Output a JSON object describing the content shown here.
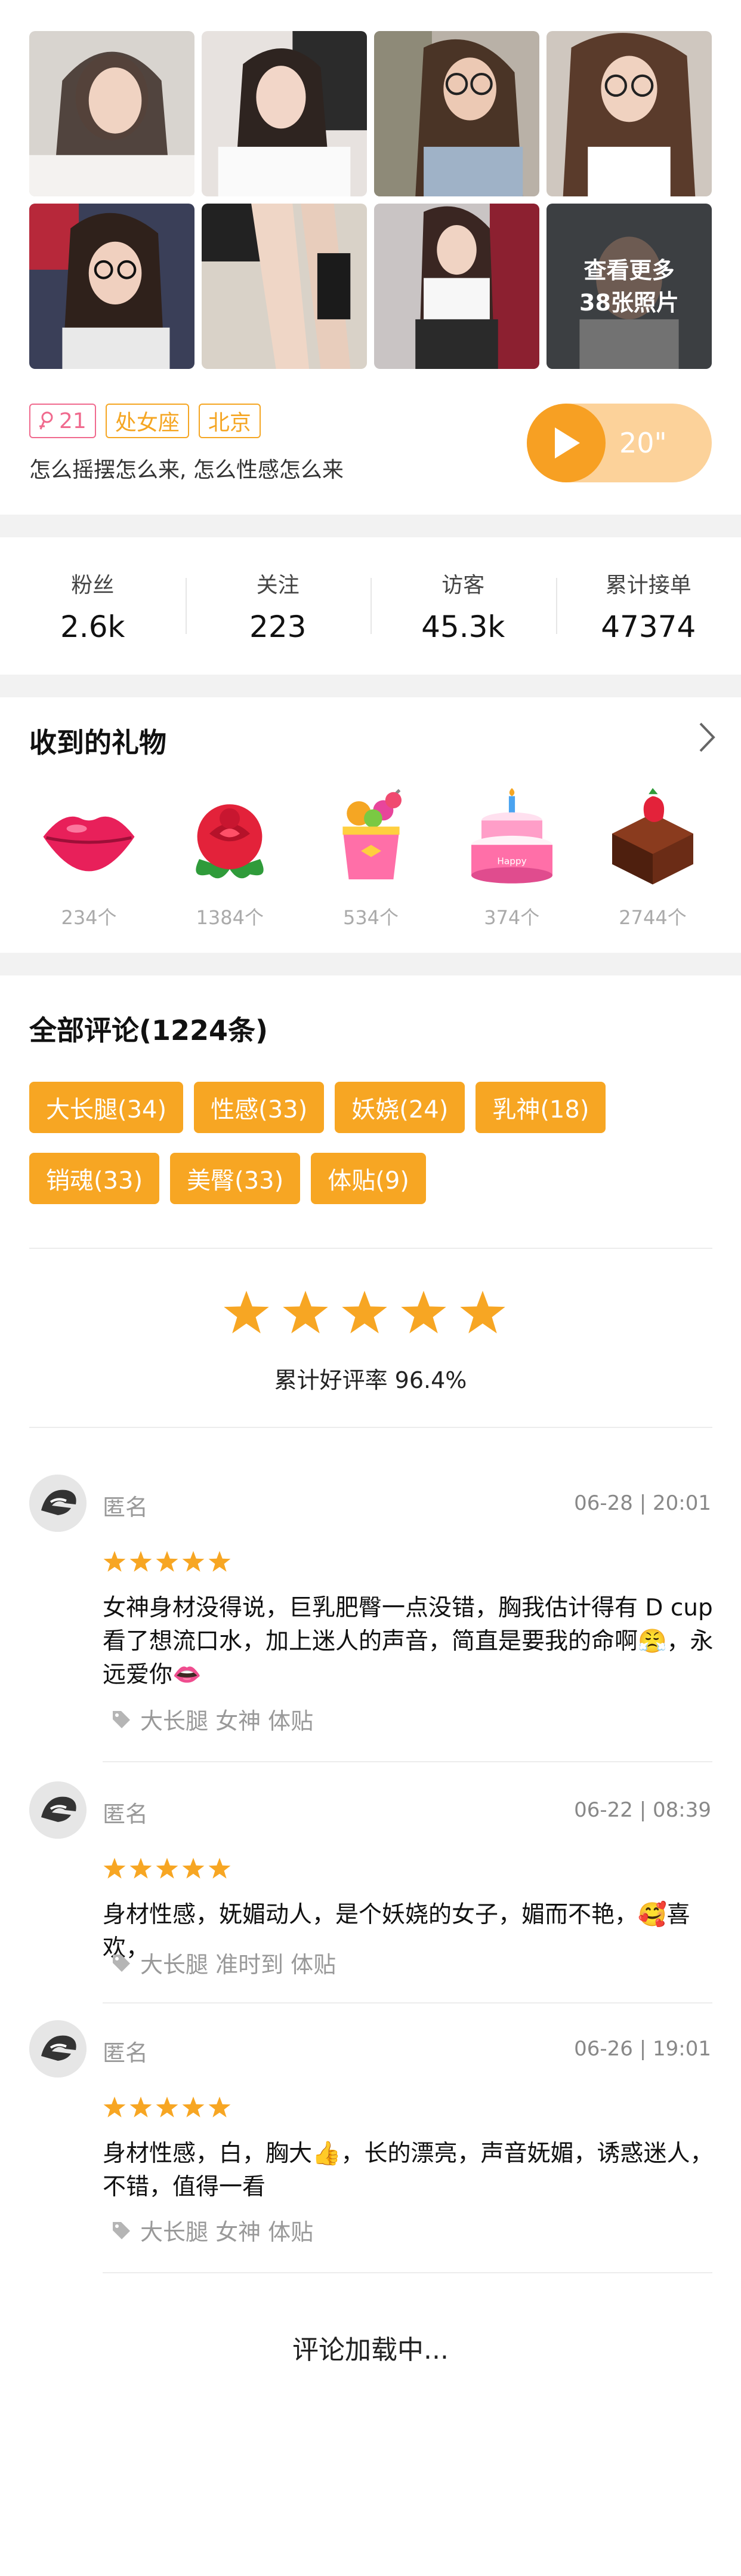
{
  "photos": {
    "more_line1": "查看更多",
    "more_line2": "38张照片"
  },
  "profile": {
    "level": "21",
    "zodiac": "处女座",
    "city": "北京",
    "signature": "怎么摇摆怎么来, 怎么性感怎么来",
    "voice_duration": "20\""
  },
  "stats": [
    {
      "label": "粉丝",
      "value": "2.6k"
    },
    {
      "label": "关注",
      "value": "223"
    },
    {
      "label": "访客",
      "value": "45.3k"
    },
    {
      "label": "累计接单",
      "value": "47374"
    }
  ],
  "gifts": {
    "title": "收到的礼物",
    "items": [
      {
        "icon": "lips-icon",
        "count": "234个"
      },
      {
        "icon": "rose-icon",
        "count": "1384个"
      },
      {
        "icon": "candy-cup-icon",
        "count": "534个"
      },
      {
        "icon": "birthday-cake-icon",
        "count": "374个"
      },
      {
        "icon": "chocolate-cake-icon",
        "count": "2744个"
      }
    ]
  },
  "comments": {
    "title": "全部评论(1224条)",
    "keywords": [
      "大长腿(34)",
      "性感(33)",
      "妖娆(24)",
      "乳神(18)",
      "销魂(33)",
      "美臀(33)",
      "体贴(9)"
    ],
    "rating": 5,
    "rate_text": "累计好评率 96.4%",
    "accent_color": "#f7a623",
    "items": [
      {
        "name": "匿名",
        "time": "06-28 | 20:01",
        "stars": 5,
        "text": "女神身材没得说，巨乳肥臀一点没错，胸我估计得有 D cup看了想流口水，加上迷人的声音，简直是要我的命啊😤，永远爱你👄",
        "tags": "大长腿 女神 体贴"
      },
      {
        "name": "匿名",
        "time": "06-22 | 08:39",
        "stars": 5,
        "text": "身材性感，妩媚动人，是个妖娆的女子，媚而不艳，🥰喜欢，",
        "tags": "大长腿 准时到 体贴"
      },
      {
        "name": "匿名",
        "time": "06-26 | 19:01",
        "stars": 5,
        "text": "身材性感，白，胸大👍，长的漂亮，声音妩媚，诱惑迷人，不错，值得一看",
        "tags": "大长腿 女神 体贴"
      }
    ],
    "loading": "评论加载中..."
  }
}
